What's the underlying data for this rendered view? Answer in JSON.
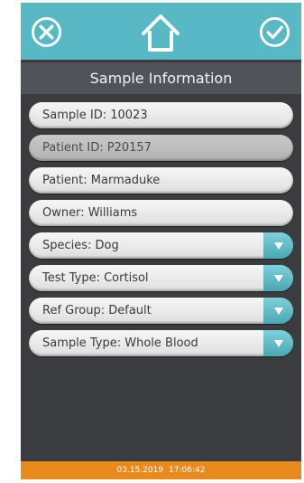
{
  "header": {
    "cancel_icon": "close-circle-icon",
    "home_icon": "home-icon",
    "confirm_icon": "checkmark-circle-icon",
    "bar_color": "#58b9c4"
  },
  "title": "Sample Information",
  "fields": [
    {
      "label": "Sample ID: 10023",
      "type": "text",
      "enabled": true
    },
    {
      "label": "Patient ID: P20157",
      "type": "text",
      "enabled": false
    },
    {
      "label": "Patient: Marmaduke",
      "type": "text",
      "enabled": true
    },
    {
      "label": "Owner: Williams",
      "type": "text",
      "enabled": true
    },
    {
      "label": "Species: Dog",
      "type": "dropdown",
      "enabled": true
    },
    {
      "label": "Test Type: Cortisol",
      "type": "dropdown",
      "enabled": true
    },
    {
      "label": "Ref Group: Default",
      "type": "dropdown",
      "enabled": true
    },
    {
      "label": "Sample Type: Whole Blood",
      "type": "dropdown",
      "enabled": true
    }
  ],
  "status": {
    "date": "03.15.2019",
    "time": "17:06:42",
    "bar_color": "#ea8a1e"
  }
}
